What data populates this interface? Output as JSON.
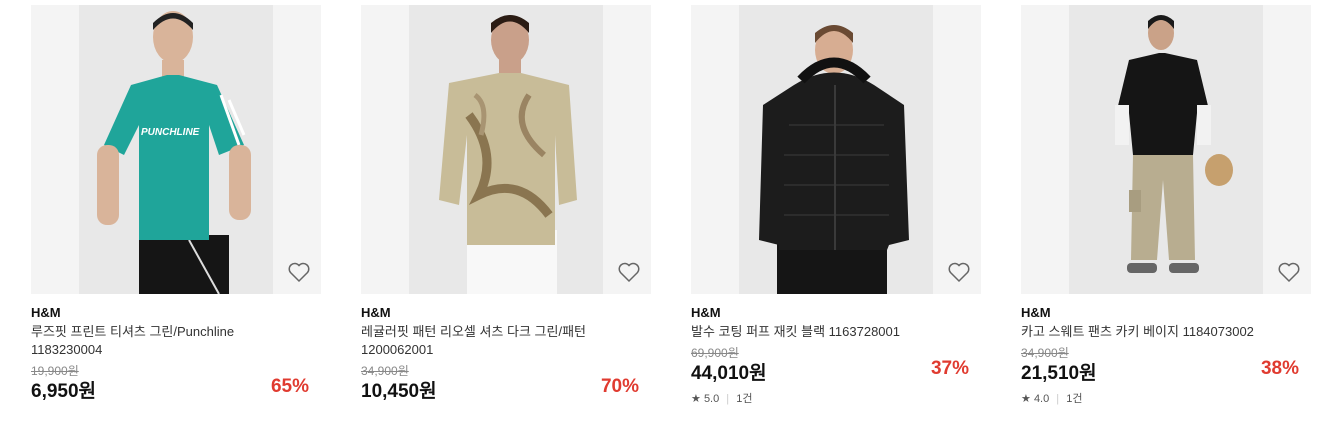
{
  "products": [
    {
      "brand": "H&M",
      "name": "루즈핏 프린트 티셔츠 그린/Punchline",
      "code": "1183230004",
      "original_price": "19,900원",
      "price": "6,950원",
      "discount": "65%",
      "shirt_text": "PUNCHLINE"
    },
    {
      "brand": "H&M",
      "name": "레귤러핏 패턴 리오셀 셔츠 다크 그린/패턴",
      "code": "1200062001",
      "original_price": "34,900원",
      "price": "10,450원",
      "discount": "70%"
    },
    {
      "brand": "H&M",
      "name": "발수 코팅 퍼프 재킷 블랙 1163728001",
      "original_price": "69,900원",
      "price": "44,010원",
      "discount": "37%",
      "rating": "5.0",
      "reviews": "1건"
    },
    {
      "brand": "H&M",
      "name": "카고 스웨트 팬츠 카키 베이지 1184073002",
      "original_price": "34,900원",
      "price": "21,510원",
      "discount": "38%",
      "rating": "4.0",
      "reviews": "1건"
    }
  ],
  "colors": {
    "discount": "#e03b30",
    "strike": "#888888"
  },
  "icons": {
    "wishlist": "heart-icon",
    "rating": "star-icon"
  }
}
